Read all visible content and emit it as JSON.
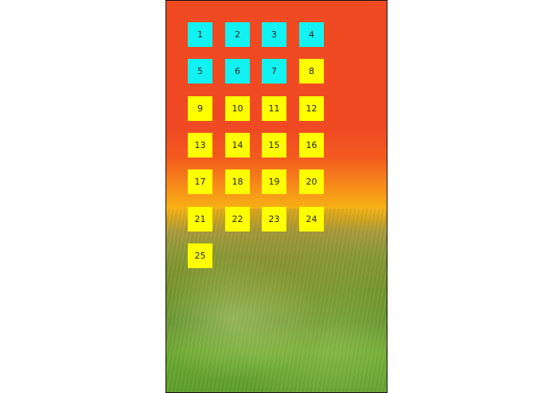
{
  "colors": {
    "selected": "#12f2f2",
    "unselected": "#ffff00"
  },
  "tiles": [
    {
      "label": "1",
      "state": "selected"
    },
    {
      "label": "2",
      "state": "selected"
    },
    {
      "label": "3",
      "state": "selected"
    },
    {
      "label": "4",
      "state": "selected"
    },
    {
      "label": "5",
      "state": "selected"
    },
    {
      "label": "6",
      "state": "selected"
    },
    {
      "label": "7",
      "state": "selected"
    },
    {
      "label": "8",
      "state": "unselected"
    },
    {
      "label": "9",
      "state": "unselected"
    },
    {
      "label": "10",
      "state": "unselected"
    },
    {
      "label": "11",
      "state": "unselected"
    },
    {
      "label": "12",
      "state": "unselected"
    },
    {
      "label": "13",
      "state": "unselected"
    },
    {
      "label": "14",
      "state": "unselected"
    },
    {
      "label": "15",
      "state": "unselected"
    },
    {
      "label": "16",
      "state": "unselected"
    },
    {
      "label": "17",
      "state": "unselected"
    },
    {
      "label": "18",
      "state": "unselected"
    },
    {
      "label": "19",
      "state": "unselected"
    },
    {
      "label": "20",
      "state": "unselected"
    },
    {
      "label": "21",
      "state": "unselected"
    },
    {
      "label": "22",
      "state": "unselected"
    },
    {
      "label": "23",
      "state": "unselected"
    },
    {
      "label": "24",
      "state": "unselected"
    },
    {
      "label": "25",
      "state": "unselected"
    }
  ]
}
